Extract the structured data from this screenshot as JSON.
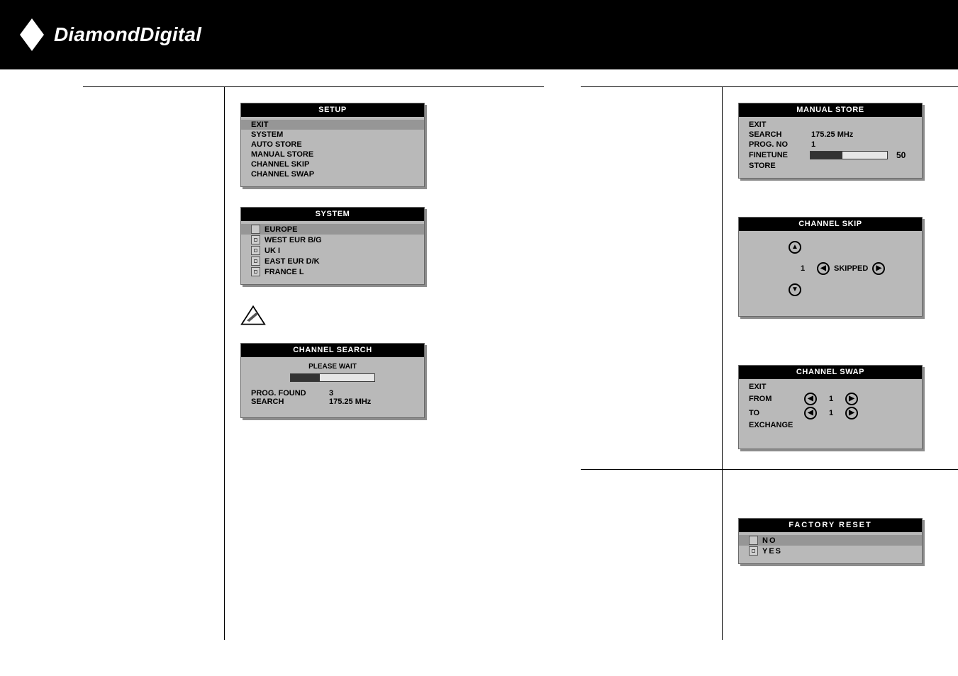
{
  "brand": "DiamondDigital",
  "setup": {
    "title": "SETUP",
    "items": [
      "EXIT",
      "SYSTEM",
      "AUTO STORE",
      "MANUAL STORE",
      "CHANNEL SKIP",
      "CHANNEL SWAP"
    ]
  },
  "system": {
    "title": "SYSTEM",
    "items": [
      "EUROPE",
      "WEST EUR B/G",
      "UK I",
      "EAST EUR D/K",
      "FRANCE L"
    ]
  },
  "channel_search": {
    "title": "CHANNEL SEARCH",
    "wait": "PLEASE WAIT",
    "prog_found_label": "PROG. FOUND",
    "prog_found_value": "3",
    "search_label": "SEARCH",
    "search_value": "175.25  MHz",
    "progress_pct": 35
  },
  "manual_store": {
    "title": "MANUAL STORE",
    "rows": {
      "exit": "EXIT",
      "search": "SEARCH",
      "search_val": "175.25 MHz",
      "prog": "PROG. NO",
      "prog_val": "1",
      "finetune": "FINETUNE",
      "finetune_val": "50",
      "finetune_pct": 42,
      "store": "STORE"
    }
  },
  "channel_skip": {
    "title": "CHANNEL SKIP",
    "channel": "1",
    "status": "SKIPPED"
  },
  "channel_swap": {
    "title": "CHANNEL SWAP",
    "rows": {
      "exit": "EXIT",
      "from": "FROM",
      "from_val": "1",
      "to": "TO",
      "to_val": "1",
      "exchange": "EXCHANGE"
    }
  },
  "factory_reset": {
    "title": "FACTORY RESET",
    "no": "NO",
    "yes": "YES"
  }
}
